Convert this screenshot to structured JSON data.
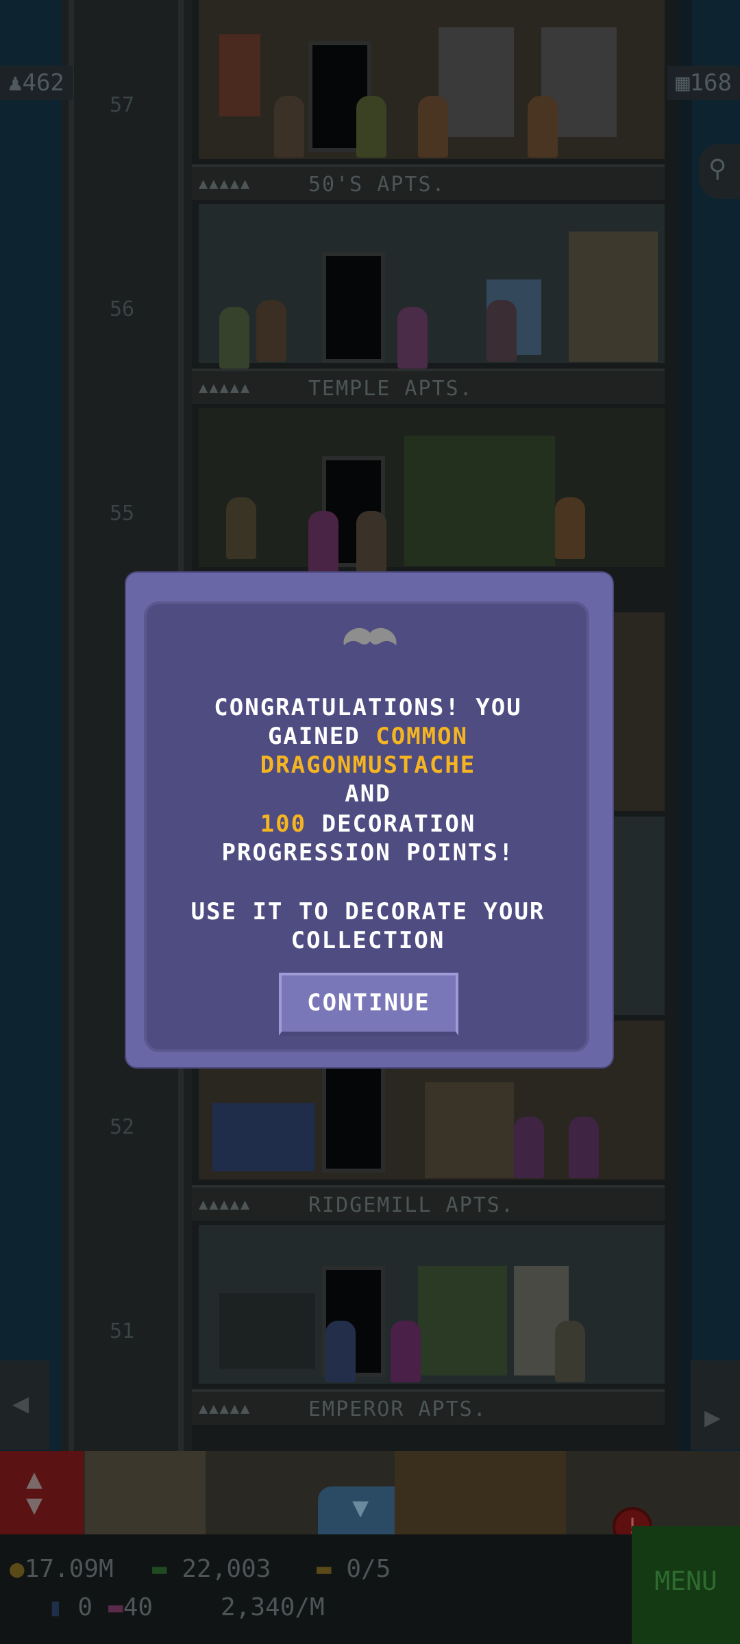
{
  "hud": {
    "population": "462",
    "floors": "168"
  },
  "floors": [
    {
      "number": "57",
      "label": "50'S APTS."
    },
    {
      "number": "56",
      "label": "TEMPLE APTS."
    },
    {
      "number": "55",
      "label": ""
    },
    {
      "number": "52",
      "label": "RIDGEMILL APTS."
    },
    {
      "number": "51",
      "label": "EMPEROR APTS."
    }
  ],
  "floor_stars": "▲▲▲▲▲",
  "dialog": {
    "icon": "mustache-icon",
    "line1": "CONGRATULATIONS! YOU",
    "line2_prefix": "GAINED ",
    "line2_highlight": "COMMON",
    "line3_highlight": "DRAGONMUSTACHE",
    "line4": "AND",
    "line5_highlight": "100",
    "line5_suffix": " DECORATION",
    "line6": "PROGRESSION POINTS!",
    "line7": "USE IT TO DECORATE YOUR",
    "line8": "COLLECTION",
    "continue_label": "CONTINUE"
  },
  "status": {
    "coins": "17.09M",
    "bux": "22,003",
    "tickets": "0/5",
    "keys": "0",
    "vip": "40",
    "income": "2,340/M",
    "menu_label": "MENU",
    "alert": "!"
  },
  "colors": {
    "dialog_bg": "#4f4c82",
    "dialog_border": "#6a67a6",
    "highlight": "#f5b521",
    "text": "#ffffff"
  }
}
